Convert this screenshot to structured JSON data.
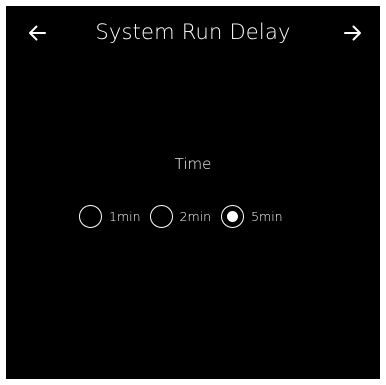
{
  "header": {
    "title": "System Run Delay",
    "back_icon": "arrow-left-icon",
    "forward_icon": "arrow-right-icon"
  },
  "time_setting": {
    "label": "Time",
    "options": [
      {
        "label": "1min",
        "selected": false
      },
      {
        "label": "2min",
        "selected": false
      },
      {
        "label": "5min",
        "selected": true
      }
    ]
  },
  "colors": {
    "background": "#000000",
    "foreground": "#ffffff"
  }
}
